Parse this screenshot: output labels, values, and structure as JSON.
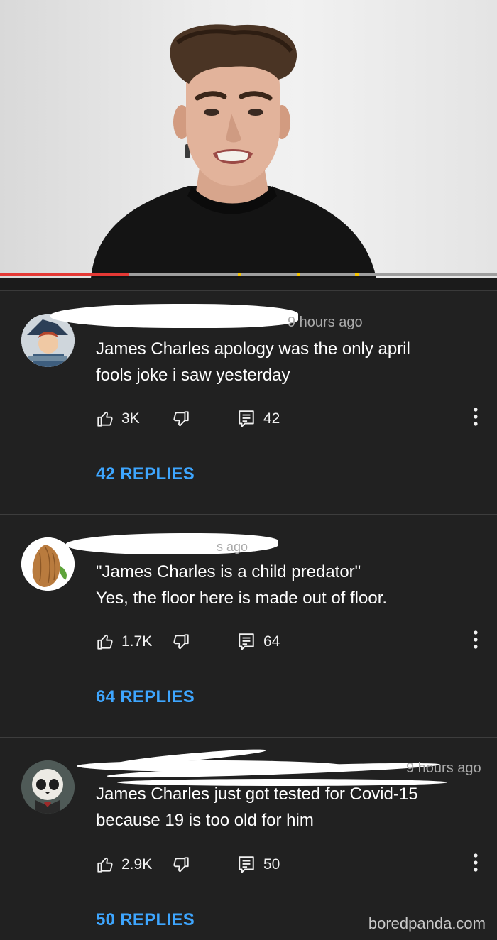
{
  "comments": [
    {
      "timestamp": "9 hours ago",
      "text_lines": [
        "James Charles apology was the only april",
        "fools joke i saw yesterday"
      ],
      "likes": "3K",
      "reply_count": "42",
      "replies_label": "42 REPLIES",
      "avatar_icon": "cartoon-avatar"
    },
    {
      "timestamp": "s ago",
      "text_lines": [
        "\"James Charles is a child predator\"",
        "Yes, the floor here is made out of floor."
      ],
      "likes": "1.7K",
      "reply_count": "64",
      "replies_label": "64 REPLIES",
      "avatar_icon": "almond-avatar"
    },
    {
      "timestamp": "9 hours ago",
      "text_lines": [
        "James Charles just got tested for Covid-15",
        "because 19 is too old for him"
      ],
      "likes": "2.9K",
      "reply_count": "50",
      "replies_label": "50 REPLIES",
      "avatar_icon": "skull-avatar"
    }
  ],
  "icons": {
    "like": "thumbs-up-icon",
    "dislike": "thumbs-down-icon",
    "reply": "reply-icon",
    "more": "more-vertical-icon"
  },
  "video": {
    "progress_fraction": 0.26
  },
  "watermark": "boredpanda.com",
  "colors": {
    "background": "#212121",
    "link": "#3ea6ff",
    "progress": "#e53935",
    "meta_text": "#aaaaaa"
  }
}
